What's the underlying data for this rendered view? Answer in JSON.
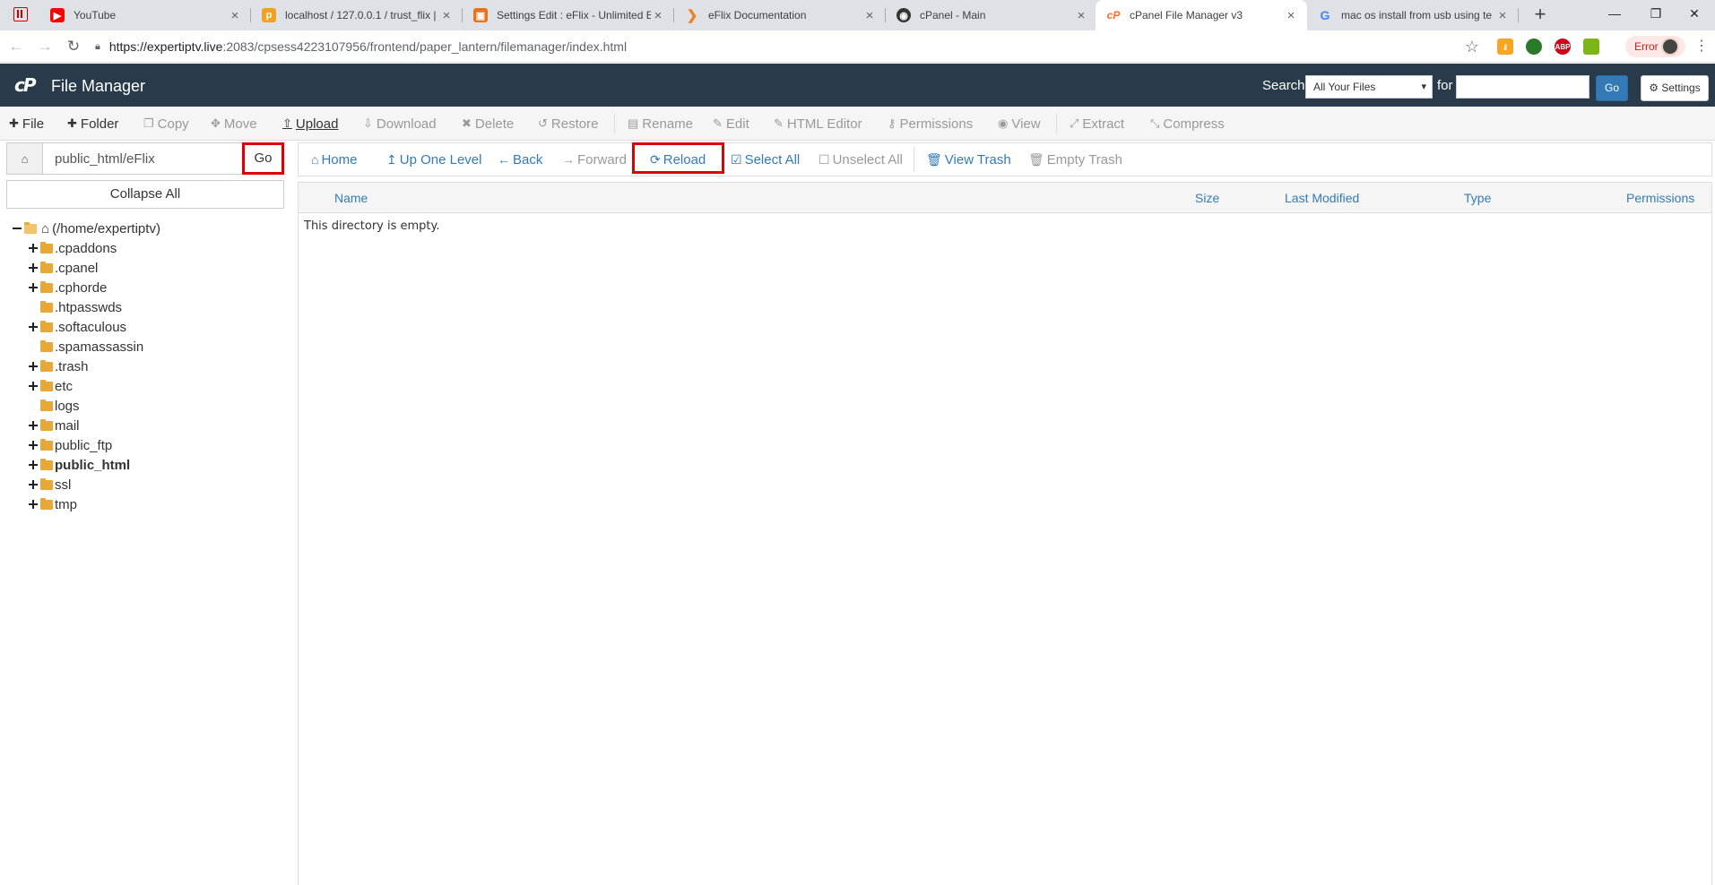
{
  "browser": {
    "tabs": [
      {
        "title": "YouTube",
        "icon": "youtube-icon",
        "color": "#ff0000",
        "active": false
      },
      {
        "title": "localhost / 127.0.0.1 / trust_flix |",
        "icon": "phpmyadmin-icon",
        "color": "#f4a020",
        "active": false
      },
      {
        "title": "Settings Edit : eFlix - Unlimited E",
        "icon": "settings-site-icon",
        "color": "#e8731a",
        "active": false
      },
      {
        "title": "eFlix Documentation",
        "icon": "play-icon",
        "color": "#f08020",
        "active": false
      },
      {
        "title": "cPanel - Main",
        "icon": "cpanel-icon",
        "color": "#333333",
        "active": false
      },
      {
        "title": "cPanel File Manager v3",
        "icon": "cpanel-icon",
        "color": "#ff6c2c",
        "active": true
      },
      {
        "title": "mac os install from usb using te",
        "icon": "google-icon",
        "color": "#4285f4",
        "active": false
      }
    ],
    "url_host": "https://expertiptv.live",
    "url_path": ":2083/cpsess4223107956/frontend/paper_lantern/filemanager/index.html",
    "error_label": "Error"
  },
  "header": {
    "logo": "cP",
    "title": "File Manager",
    "search_label": "Search",
    "search_scope": "All Your Files",
    "for_label": "for",
    "search_value": "",
    "go_label": "Go",
    "settings_label": "Settings"
  },
  "toolbar": {
    "items": [
      {
        "label": "File",
        "icon": "plus-icon",
        "enabled": true
      },
      {
        "label": "Folder",
        "icon": "plus-icon",
        "enabled": true
      },
      {
        "label": "Copy",
        "icon": "copy-icon",
        "enabled": false
      },
      {
        "label": "Move",
        "icon": "move-icon",
        "enabled": false
      },
      {
        "label": "Upload",
        "icon": "upload-icon",
        "enabled": true
      },
      {
        "label": "Download",
        "icon": "download-icon",
        "enabled": false
      },
      {
        "label": "Delete",
        "icon": "delete-icon",
        "enabled": false
      },
      {
        "label": "Restore",
        "icon": "restore-icon",
        "enabled": false
      },
      {
        "label": "Rename",
        "icon": "rename-icon",
        "enabled": false
      },
      {
        "label": "Edit",
        "icon": "pencil-icon",
        "enabled": false
      },
      {
        "label": "HTML Editor",
        "icon": "html-editor-icon",
        "enabled": false
      },
      {
        "label": "Permissions",
        "icon": "key-icon",
        "enabled": false
      },
      {
        "label": "View",
        "icon": "eye-icon",
        "enabled": false
      },
      {
        "label": "Extract",
        "icon": "extract-icon",
        "enabled": false
      },
      {
        "label": "Compress",
        "icon": "compress-icon",
        "enabled": false
      }
    ]
  },
  "left": {
    "path_value": "public_html/eFlix",
    "go_label": "Go",
    "collapse_label": "Collapse All",
    "root_label": "(/home/expertiptv)",
    "tree": [
      {
        "label": ".cpaddons",
        "expandable": true,
        "bold": false
      },
      {
        "label": ".cpanel",
        "expandable": true,
        "bold": false
      },
      {
        "label": ".cphorde",
        "expandable": true,
        "bold": false
      },
      {
        "label": ".htpasswds",
        "expandable": false,
        "bold": false
      },
      {
        "label": ".softaculous",
        "expandable": true,
        "bold": false
      },
      {
        "label": ".spamassassin",
        "expandable": false,
        "bold": false
      },
      {
        "label": ".trash",
        "expandable": true,
        "bold": false
      },
      {
        "label": "etc",
        "expandable": true,
        "bold": false
      },
      {
        "label": "logs",
        "expandable": false,
        "bold": false
      },
      {
        "label": "mail",
        "expandable": true,
        "bold": false
      },
      {
        "label": "public_ftp",
        "expandable": true,
        "bold": false
      },
      {
        "label": "public_html",
        "expandable": true,
        "bold": true
      },
      {
        "label": "ssl",
        "expandable": true,
        "bold": false
      },
      {
        "label": "tmp",
        "expandable": true,
        "bold": false
      }
    ]
  },
  "main": {
    "nav": [
      {
        "label": "Home",
        "icon": "home-icon",
        "enabled": true
      },
      {
        "label": "Up One Level",
        "icon": "level-up-icon",
        "enabled": true
      },
      {
        "label": "Back",
        "icon": "arrow-left-icon",
        "enabled": true
      },
      {
        "label": "Forward",
        "icon": "arrow-right-icon",
        "enabled": false
      },
      {
        "label": "Reload",
        "icon": "refresh-icon",
        "enabled": true
      },
      {
        "label": "Select All",
        "icon": "checkbox-checked-icon",
        "enabled": true
      },
      {
        "label": "Unselect All",
        "icon": "checkbox-empty-icon",
        "enabled": false
      },
      {
        "label": "View Trash",
        "icon": "trash-icon",
        "enabled": true
      },
      {
        "label": "Empty Trash",
        "icon": "trash-icon",
        "enabled": false
      }
    ],
    "columns": [
      "Name",
      "Size",
      "Last Modified",
      "Type",
      "Permissions"
    ],
    "empty_message": "This directory is empty."
  },
  "colors": {
    "header_bg": "#293a4a",
    "link": "#337ab7",
    "highlight": "#dd0000",
    "folder": "#e8a838"
  }
}
